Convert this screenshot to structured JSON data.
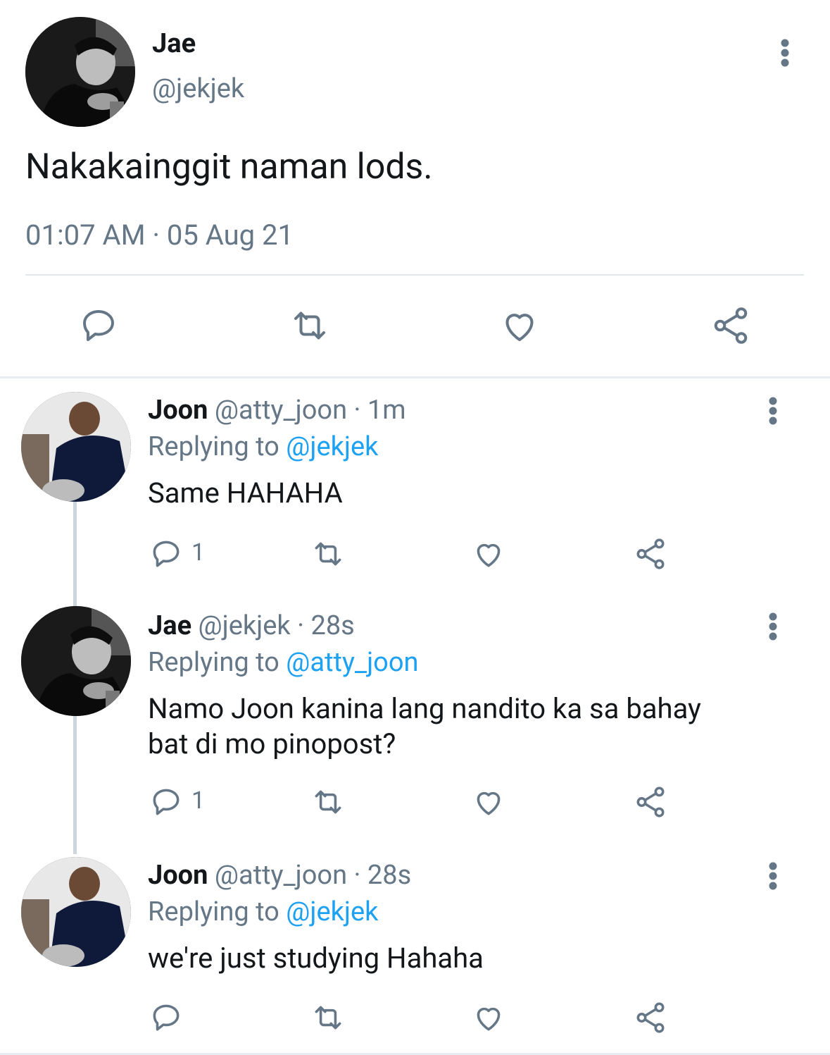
{
  "main_tweet": {
    "display_name": "Jae",
    "handle": "@jekjek",
    "text": "Nakakainggit naman lods.",
    "timestamp": "01:07 AM · 05 Aug 21"
  },
  "replies": [
    {
      "display_name": "Joon",
      "handle": "@atty_joon",
      "time": "· 1m",
      "replying_prefix": "Replying to",
      "replying_to": "@jekjek",
      "text_lines": [
        "Same HAHAHA"
      ],
      "reply_count": "1"
    },
    {
      "display_name": "Jae",
      "handle": "@jekjek",
      "time": "· 28s",
      "replying_prefix": "Replying to",
      "replying_to": "@atty_joon",
      "text_lines": [
        "Namo Joon kanina lang nandito ka sa bahay",
        "bat di mo pinopost?"
      ],
      "reply_count": "1"
    },
    {
      "display_name": "Joon",
      "handle": "@atty_joon",
      "time": "· 28s",
      "replying_prefix": "Replying to",
      "replying_to": "@jekjek",
      "text_lines": [
        "we're just studying Hahaha"
      ],
      "reply_count": ""
    }
  ],
  "icons": [
    "reply-icon",
    "retweet-icon",
    "like-icon",
    "share-icon",
    "more-options-icon"
  ],
  "colors": {
    "text": "#14171a",
    "secondary": "#657786",
    "link": "#1da1f2",
    "divider": "#e1e8ed"
  }
}
